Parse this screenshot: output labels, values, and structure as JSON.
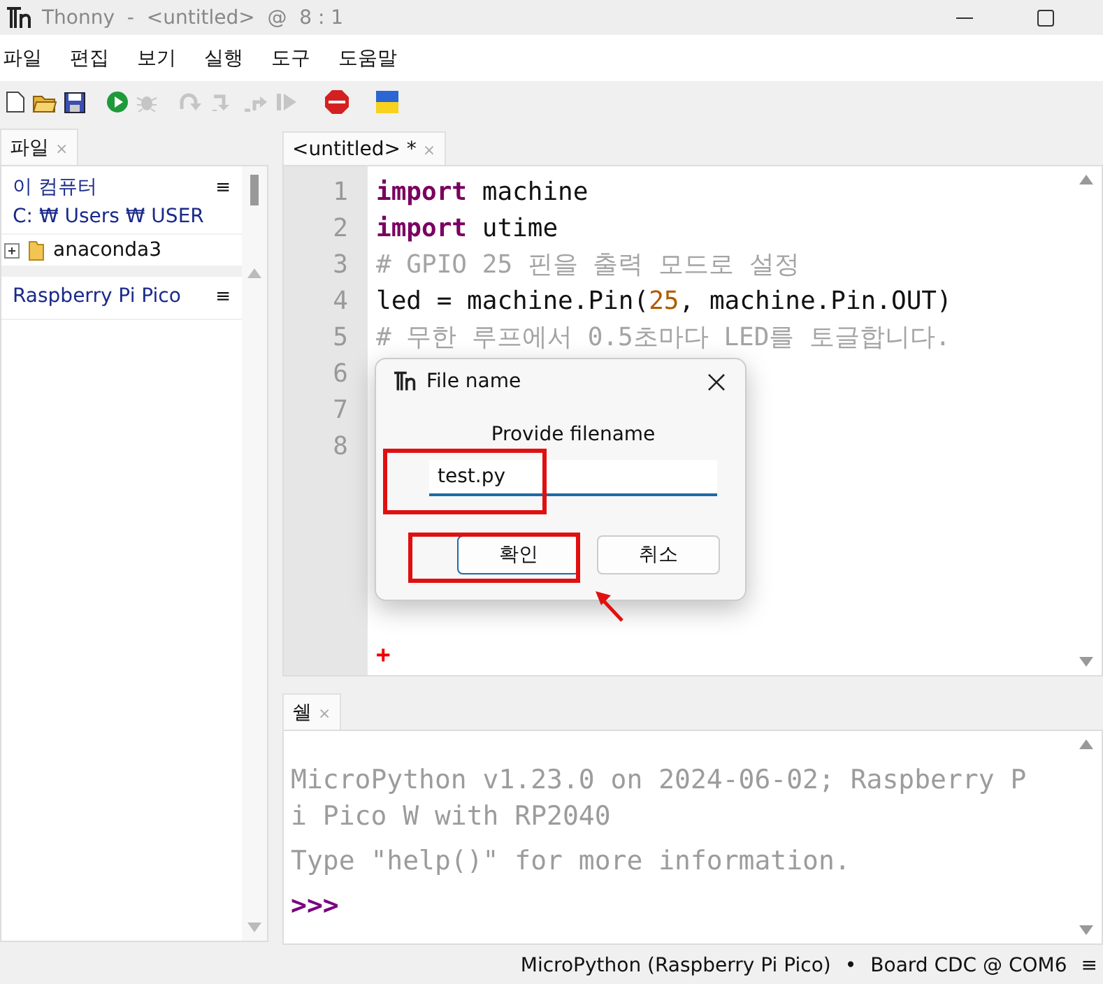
{
  "window": {
    "title": "Thonny  -  <untitled>  @  8 : 1"
  },
  "menu": [
    "파일",
    "편집",
    "보기",
    "실행",
    "도구",
    "도움말"
  ],
  "toolbar": [
    {
      "kind": "new",
      "disabled": false
    },
    {
      "kind": "open",
      "disabled": false
    },
    {
      "kind": "save",
      "disabled": false
    },
    {
      "kind": "run",
      "disabled": false
    },
    {
      "kind": "debug",
      "disabled": true
    },
    {
      "kind": "step_over",
      "disabled": true
    },
    {
      "kind": "step_into",
      "disabled": true
    },
    {
      "kind": "step_out",
      "disabled": true
    },
    {
      "kind": "resume",
      "disabled": true
    },
    {
      "kind": "stop",
      "disabled": false
    },
    {
      "kind": "flag",
      "disabled": false
    }
  ],
  "files_panel": {
    "tab": {
      "label": "파일",
      "close": "×"
    },
    "computer": {
      "title": "이 컴퓨터",
      "menu": "≡",
      "path": "C: ₩ Users ₩ USER",
      "items": [
        {
          "name": "anaconda3",
          "expanded": false
        }
      ]
    },
    "device": {
      "title": "Raspberry Pi Pico",
      "menu": "≡"
    }
  },
  "editor": {
    "tab": {
      "label": "<untitled> *",
      "close": "×"
    },
    "lines": [
      {
        "number": "1",
        "tokens": [
          {
            "kind": "keyword",
            "text": "import"
          },
          {
            "kind": "name",
            "text": " machine"
          }
        ]
      },
      {
        "number": "2",
        "tokens": [
          {
            "kind": "keyword",
            "text": "import"
          },
          {
            "kind": "name",
            "text": " utime"
          }
        ]
      },
      {
        "number": "3",
        "tokens": [
          {
            "kind": "comment",
            "text": "# GPIO 25 핀을 출력 모드로 설정"
          }
        ]
      },
      {
        "number": "4",
        "tokens": [
          {
            "kind": "name",
            "text": "led = machine.Pin("
          },
          {
            "kind": "number",
            "text": "25"
          },
          {
            "kind": "name",
            "text": ", machine.Pin.OUT)"
          }
        ]
      },
      {
        "number": "5",
        "tokens": [
          {
            "kind": "comment",
            "text": "# 무한 루프에서 0.5초마다 LED를 토글합니다."
          }
        ]
      },
      {
        "number": "6"
      },
      {
        "number": "7"
      },
      {
        "number": "8"
      }
    ],
    "marker": "+"
  },
  "dialog": {
    "title": "File name",
    "prompt": "Provide filename",
    "value": "test.py",
    "buttons": [
      {
        "label": "확인",
        "default": true
      },
      {
        "label": "취소",
        "default": false
      }
    ]
  },
  "shell": {
    "tab": {
      "label": "쉘",
      "close": "×"
    },
    "output": [
      {
        "kind": "info",
        "text": "MicroPython v1.23.0 on 2024-06-02; Raspberry Pi Pico W with RP2040"
      },
      {
        "kind": "info",
        "text": "Type \"help()\" for more information."
      },
      {
        "kind": "prompt",
        "text": ">>>"
      }
    ]
  },
  "status_bar": {
    "interpreter": "MicroPython (Raspberry Pi Pico)",
    "separator": "•",
    "port": "Board CDC @ COM6",
    "menu": "≡"
  }
}
